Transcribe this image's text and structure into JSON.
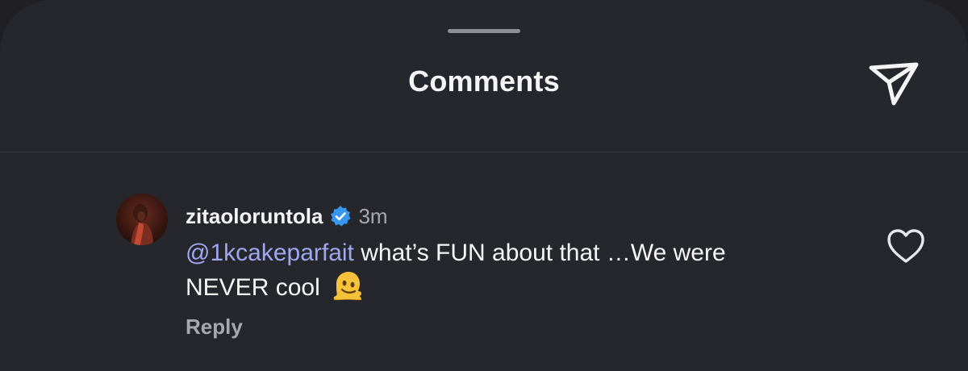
{
  "header": {
    "title": "Comments",
    "share_icon": "send-icon"
  },
  "comment": {
    "username": "zitaoloruntola",
    "verified": true,
    "timestamp": "3m",
    "mention": "@1kcakeparfait",
    "text_line1": " what’s FUN about that …We were",
    "text_line2": "NEVER cool",
    "emoji": "melting-face-emoji",
    "reply_label": "Reply",
    "like_icon": "heart-icon"
  },
  "colors": {
    "background": "#26272c",
    "text": "#f5f5f5",
    "secondary_text": "#a8a9ae",
    "mention": "#a0a7f0",
    "verified_badge": "#3797f0"
  }
}
